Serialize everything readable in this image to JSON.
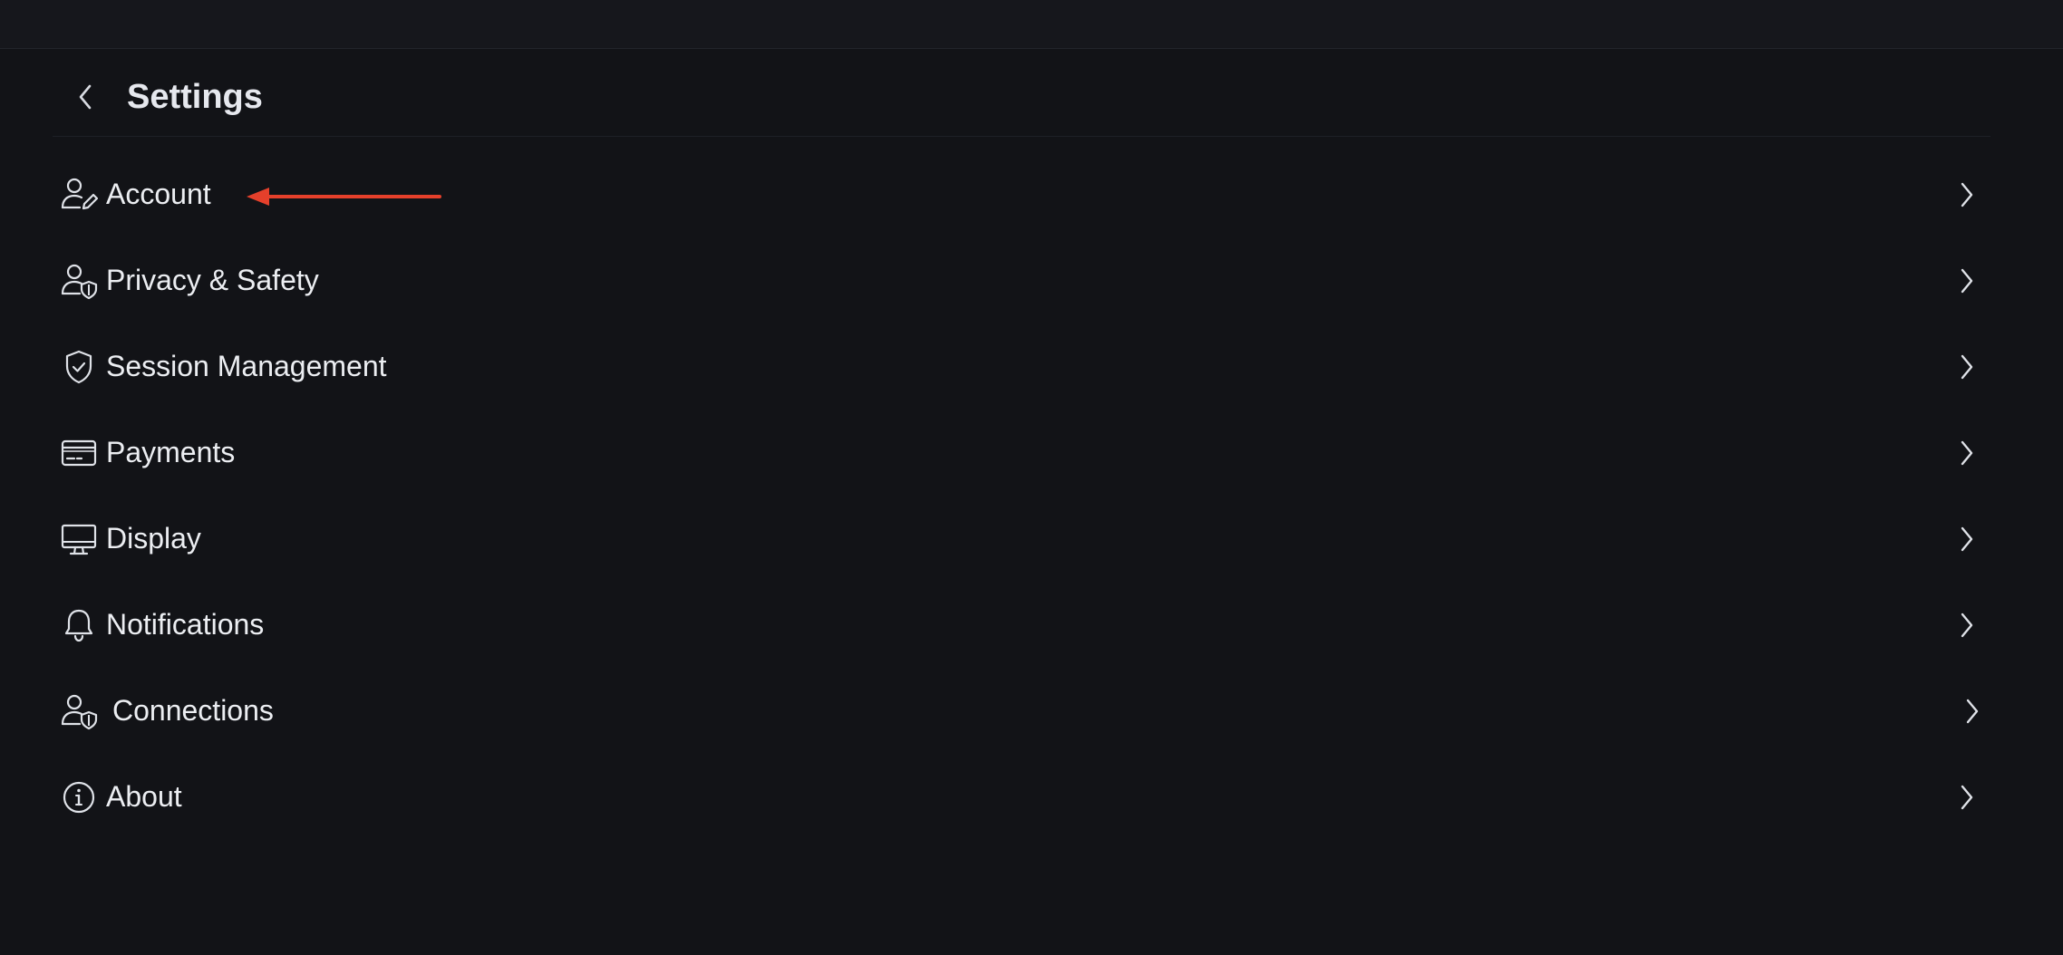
{
  "header": {
    "title": "Settings",
    "back_icon": "chevron-left-icon"
  },
  "menu": {
    "items": [
      {
        "label": "Account",
        "icon": "user-edit-icon"
      },
      {
        "label": "Privacy & Safety",
        "icon": "user-shield-icon"
      },
      {
        "label": "Session Management",
        "icon": "shield-check-icon"
      },
      {
        "label": "Payments",
        "icon": "credit-card-icon"
      },
      {
        "label": "Display",
        "icon": "monitor-icon"
      },
      {
        "label": "Notifications",
        "icon": "bell-icon"
      },
      {
        "label": "Connections",
        "icon": "user-shield-icon"
      },
      {
        "label": "About",
        "icon": "info-icon"
      }
    ],
    "item_chevron_icon": "chevron-right-icon"
  },
  "annotation": {
    "arrow_color": "#e5402b",
    "target": "Account"
  },
  "colors": {
    "background": "#121317",
    "topbar": "#16171c",
    "text": "#eceef2"
  }
}
